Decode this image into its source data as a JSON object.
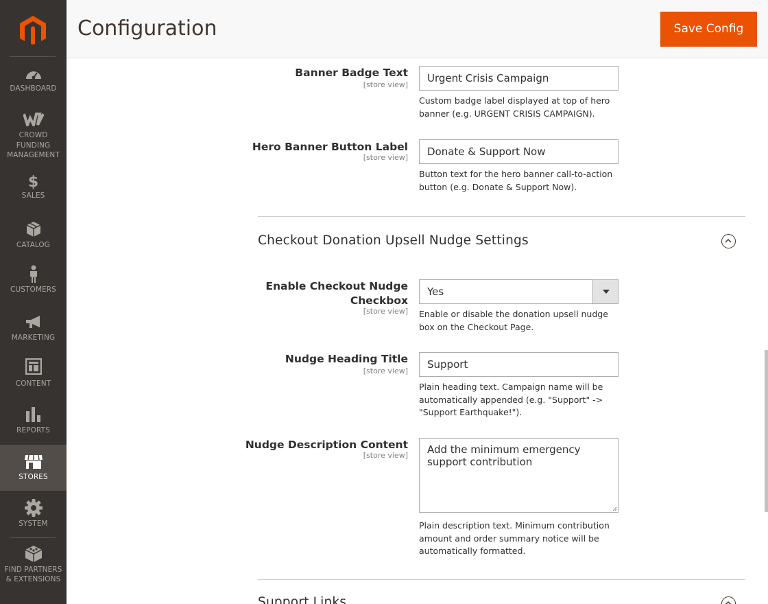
{
  "app": {
    "page_title": "Configuration",
    "save_button": "Save Config",
    "accent_color": "#eb5202"
  },
  "sidebar": {
    "logo": "magento-logo-icon",
    "items": [
      {
        "label": "DASHBOARD",
        "icon": "dashboard-icon",
        "active": false
      },
      {
        "label": "CROWD FUNDING MANAGEMENT",
        "label_lines": [
          "CROWD",
          "FUNDING",
          "MANAGEMENT"
        ],
        "icon": "crowdfunding-icon",
        "active": false
      },
      {
        "label": "SALES",
        "icon": "dollar-icon",
        "active": false
      },
      {
        "label": "CATALOG",
        "icon": "box-icon",
        "active": false
      },
      {
        "label": "CUSTOMERS",
        "icon": "person-icon",
        "active": false
      },
      {
        "label": "MARKETING",
        "icon": "megaphone-icon",
        "active": false
      },
      {
        "label": "CONTENT",
        "icon": "layout-icon",
        "active": false
      },
      {
        "label": "REPORTS",
        "icon": "bar-chart-icon",
        "active": false
      },
      {
        "label": "STORES",
        "icon": "store-icon",
        "active": true
      },
      {
        "label": "SYSTEM",
        "icon": "gear-icon",
        "active": false
      },
      {
        "label": "FIND PARTNERS & EXTENSIONS",
        "label_lines": [
          "FIND PARTNERS",
          "& EXTENSIONS"
        ],
        "icon": "blocks-icon",
        "active": false
      }
    ]
  },
  "fields": {
    "banner_badge": {
      "label": "Banner Badge Text",
      "scope": "[store view]",
      "value": "Urgent Crisis Campaign",
      "note": "Custom badge label displayed at top of hero banner (e.g. URGENT CRISIS CAMPAIGN)."
    },
    "hero_button": {
      "label": "Hero Banner Button Label",
      "scope": "[store view]",
      "value": "Donate & Support Now",
      "note": "Button text for the hero banner call-to-action button (e.g. Donate & Support Now)."
    }
  },
  "sections": {
    "checkout_nudge": {
      "title": "Checkout Donation Upsell Nudge Settings",
      "expanded": true,
      "fields": {
        "enable_nudge": {
          "label": "Enable Checkout Nudge Checkbox",
          "label_lines": [
            "Enable Checkout Nudge",
            "Checkbox"
          ],
          "scope": "[store view]",
          "value": "Yes",
          "note": "Enable or disable the donation upsell nudge box on the Checkout Page."
        },
        "heading_title": {
          "label": "Nudge Heading Title",
          "scope": "[store view]",
          "value": "Support",
          "note": "Plain heading text. Campaign name will be automatically appended (e.g. \"Support\" -> \"Support Earthquake!\")."
        },
        "description": {
          "label": "Nudge Description Content",
          "scope": "[store view]",
          "value": "Add the minimum emergency support contribution",
          "note": "Plain description text. Minimum contribution amount and order summary notice will be automatically formatted."
        }
      }
    },
    "support_links": {
      "title": "Support Links",
      "expanded": true
    }
  }
}
